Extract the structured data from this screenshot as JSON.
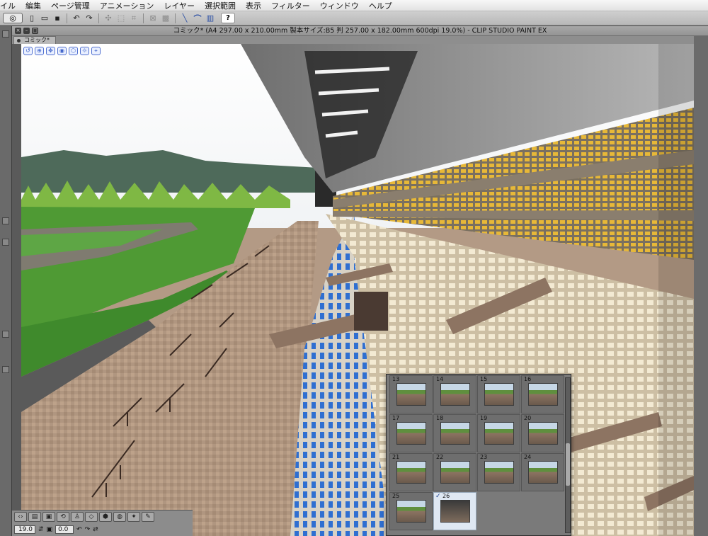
{
  "menubar": {
    "items": [
      "イル",
      "編集",
      "ページ管理",
      "アニメーション",
      "レイヤー",
      "選択範囲",
      "表示",
      "フィルター",
      "ウィンドウ",
      "ヘルプ"
    ]
  },
  "toolbar": {
    "icons": [
      "clip-studio-logo-icon",
      "new-file-icon",
      "open-file-icon",
      "save-icon",
      "undo-icon",
      "redo-icon",
      "transform-icon",
      "deselect-icon",
      "crop-icon",
      "clear-icon",
      "fill-icon",
      "ruler-snap-icon",
      "special-ruler-icon",
      "grid-snap-icon",
      "help-icon"
    ],
    "help_label": "?"
  },
  "window": {
    "title": "コミック* (A4 297.00 x 210.00mm 製本サイズ:B5 判 257.00 x 182.00mm 600dpi 19.0%)  - CLIP STUDIO PAINT EX"
  },
  "document_tab": {
    "label": "コミック*"
  },
  "canvas_nav_icons": [
    "rotate-view-icon",
    "zoom-icon",
    "pan-icon",
    "camera-icon",
    "object-icon",
    "light-icon",
    "perspective-icon"
  ],
  "status": {
    "zoom": "19.0",
    "angle": "0.0"
  },
  "frame_panel": {
    "frames": [
      {
        "num": "13",
        "selected": false
      },
      {
        "num": "14",
        "selected": false
      },
      {
        "num": "15",
        "selected": false
      },
      {
        "num": "16",
        "selected": false
      },
      {
        "num": "17",
        "selected": false
      },
      {
        "num": "18",
        "selected": false
      },
      {
        "num": "19",
        "selected": false
      },
      {
        "num": "20",
        "selected": false
      },
      {
        "num": "21",
        "selected": false
      },
      {
        "num": "22",
        "selected": false
      },
      {
        "num": "23",
        "selected": false
      },
      {
        "num": "24",
        "selected": false
      },
      {
        "num": "25",
        "selected": false
      },
      {
        "num": "26",
        "selected": true
      }
    ]
  },
  "colors": {
    "sky": "#ffffff",
    "turf": "#4f9a34",
    "dirt_track": "#7f7b70",
    "ground_tile": "#b0957c",
    "seat_blue": "#2f6fd1",
    "seat_yellow": "#e7b838",
    "seat_cream": "#efe3c6",
    "roof": "#8f8f8f"
  }
}
